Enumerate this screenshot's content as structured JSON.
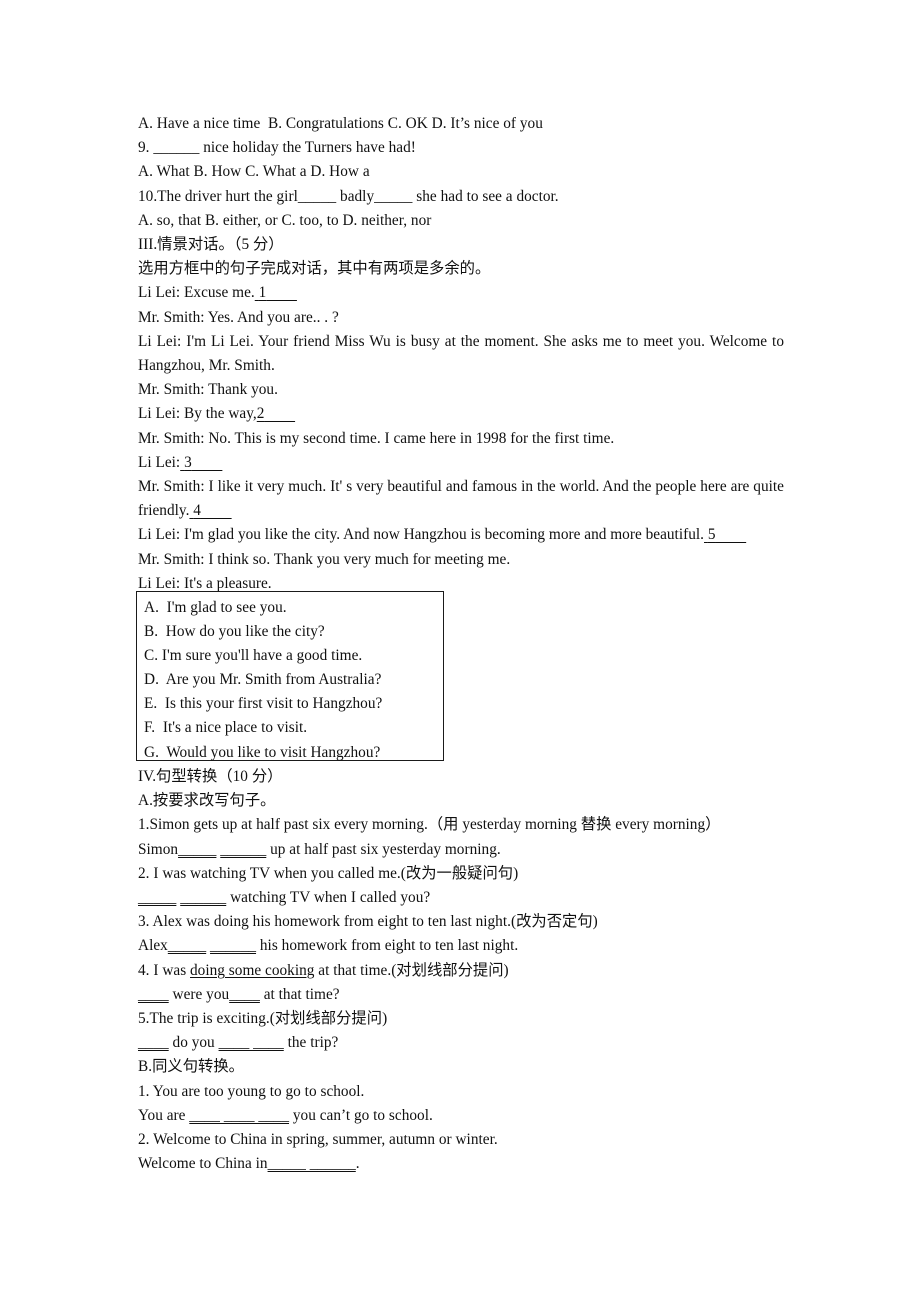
{
  "document": {
    "type": "english-exam-worksheet",
    "language": "zh-CN/en",
    "page_background": "#ffffff",
    "text_color": "#101010"
  },
  "section_two_tail": {
    "q8_options": "A. Have a nice time  B. Congratulations C. OK D. It’s nice of you",
    "q9_stem": "9. ______ nice holiday the Turners have had!",
    "q9_options": "A. What B. How C. What a D. How a",
    "q10_stem": "10.The driver hurt the girl_____ badly_____ she had to see a doctor.",
    "q10_options": "A. so, that B. either, or C. too, to D. neither, nor"
  },
  "section_three": {
    "heading": "III.情景对话。（5 分）",
    "instruction": "选用方框中的句子完成对话，其中有两项是多余的。",
    "dialogue": [
      {
        "speaker_line": "Li Lei: Excuse me.",
        "blank": "1",
        "justified": false
      },
      {
        "speaker_line": "Mr. Smith: Yes. And you are.. . ?",
        "blank": "",
        "justified": false
      },
      {
        "speaker_line": "Li Lei: I'm Li Lei. Your friend Miss Wu is busy at the moment. She asks me to meet you. Welcome to Hangzhou, Mr. Smith.",
        "blank": "",
        "justified": true
      },
      {
        "speaker_line": "Mr. Smith: Thank you.",
        "blank": "",
        "justified": false
      },
      {
        "speaker_line": "Li Lei: By the way,",
        "blank": "2",
        "justified": false
      },
      {
        "speaker_line": "Mr. Smith: No. This is my second time. I came here in 1998 for the first time.",
        "blank": "",
        "justified": false
      },
      {
        "speaker_line": "Li Lei:",
        "blank": "3",
        "justified": false
      },
      {
        "speaker_line": "Mr. Smith: I like it very much. It' s very beautiful and famous in the world. And the people here are quite friendly.",
        "blank": "4",
        "justified": true
      },
      {
        "speaker_line": "Li Lei: I'm glad you like the city. And now Hangzhou is becoming more and more beautiful.",
        "blank": "5",
        "justified": false
      },
      {
        "speaker_line": "Mr. Smith: I think so. Thank you very much for meeting me.",
        "blank": "",
        "justified": false
      },
      {
        "speaker_line": "Li Lei: It's a pleasure.",
        "blank": "",
        "justified": false
      }
    ],
    "option_box": [
      "A.  I'm glad to see you.",
      "B.  How do you like the city?",
      "C. I'm sure you'll have a good time.",
      "D.  Are you Mr. Smith from Australia?",
      "E.  Is this your first visit to Hangzhou?",
      "F.  It's a nice place to visit.",
      "G.  Would you like to visit Hangzhou?"
    ]
  },
  "section_four": {
    "heading": "IV.句型转换（10 分）",
    "part_a_heading": "A.按要求改写句子。",
    "items_a": [
      {
        "prompt": "1.Simon gets up at half past six every morning.（用 yesterday morning 替换 every morning）",
        "answer_pre": "Simon",
        "blank1": "_____",
        "gap": " ",
        "blank2": "______",
        "answer_post": " up at half past six yesterday morning."
      },
      {
        "prompt": "2. I was watching TV when you called me.(改为一般疑问句)",
        "answer_pre": "",
        "blank1": "_____",
        "gap": " ",
        "blank2": "______",
        "answer_post": " watching TV when I called you?"
      },
      {
        "prompt": "3. Alex was doing his homework from eight to ten last night.(改为否定句)",
        "answer_pre": "Alex",
        "blank1": "_____",
        "gap": " ",
        "blank2": "______",
        "answer_post": " his homework from eight to ten last night."
      },
      {
        "prompt_pre": "4. I was ",
        "prompt_underlined": "doing some cooking",
        "prompt_post": " at that time.(对划线部分提问)",
        "answer_pre": "",
        "blank1": "____",
        "gap": " were you",
        "blank2": "____",
        "answer_post": " at that time?"
      },
      {
        "prompt": "5.The trip is exciting.(对划线部分提问)",
        "answer_pre": "",
        "blank1": "____",
        "gap": " do you ",
        "blank2": "____ ____",
        "answer_post": " the trip?"
      }
    ],
    "part_b_heading": "B.同义句转换。",
    "items_b": [
      {
        "prompt": "1. You are too young to go to school.",
        "answer_pre": "You are ",
        "blanks": "____ ____ ____",
        "answer_post": " you can’t go to school."
      },
      {
        "prompt": "2. Welcome to China in spring, summer, autumn or winter.",
        "answer_pre": "Welcome to China in",
        "blanks": "_____ ______",
        "answer_post": "."
      }
    ]
  }
}
